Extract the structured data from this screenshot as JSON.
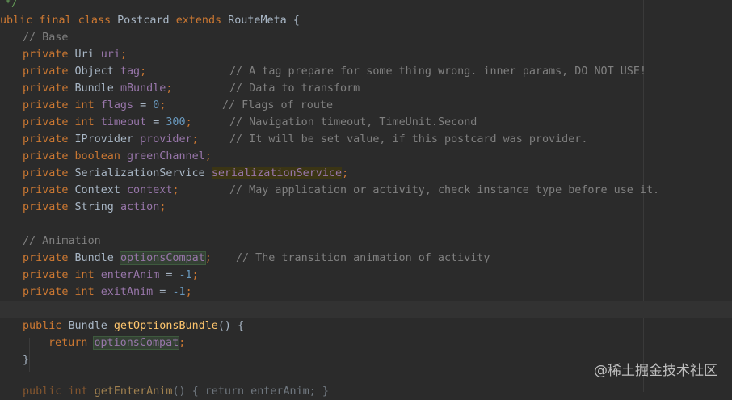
{
  "code": {
    "l0": "*/",
    "l1": {
      "kw1": "ublic final class",
      "name": "Postcard",
      "kw2": "extends",
      "base": "RouteMeta {"
    },
    "l2": "// Base",
    "fields": [
      {
        "kw": "private",
        "type": "Uri",
        "name": "uri",
        "tail": ";",
        "comment": ""
      },
      {
        "kw": "private",
        "type": "Object",
        "name": "tag",
        "tail": ";",
        "comment": "// A tag prepare for some thing wrong. inner params, DO NOT USE!"
      },
      {
        "kw": "private",
        "type": "Bundle",
        "name": "mBundle",
        "tail": ";",
        "comment": "// Data to transform"
      },
      {
        "kw": "private int",
        "type": "",
        "name": "flags",
        "assign": " = ",
        "value": "0",
        "tail": ";",
        "comment": "// Flags of route"
      },
      {
        "kw": "private int",
        "type": "",
        "name": "timeout",
        "assign": " = ",
        "value": "300",
        "tail": ";",
        "comment": "// Navigation timeout, TimeUnit.Second"
      },
      {
        "kw": "private",
        "type": "IProvider",
        "name": "provider",
        "tail": ";",
        "comment": "// It will be set value, if this postcard was provider."
      },
      {
        "kw": "private boolean",
        "type": "",
        "name": "greenChannel",
        "tail": ";",
        "comment": ""
      },
      {
        "kw": "private",
        "type": "SerializationService",
        "name": "serializationService",
        "tail": ";",
        "comment": ""
      },
      {
        "kw": "private",
        "type": "Context",
        "name": "context",
        "tail": ";",
        "comment": "// May application or activity, check instance type before use it."
      },
      {
        "kw": "private",
        "type": "String",
        "name": "action",
        "tail": ";",
        "comment": ""
      }
    ],
    "anim_comment": "// Animation",
    "anim": [
      {
        "kw": "private",
        "type": "Bundle",
        "name": "optionsCompat",
        "tail": ";",
        "comment": "// The transition animation of activity"
      },
      {
        "kw": "private int",
        "type": "",
        "name": "enterAnim",
        "assign": " = ",
        "value": "-1",
        "tail": ";",
        "comment": ""
      },
      {
        "kw": "private int",
        "type": "",
        "name": "exitAnim",
        "assign": " = ",
        "value": "-1",
        "tail": ";",
        "comment": ""
      }
    ],
    "method": {
      "kw": "public",
      "type": "Bundle",
      "name": "getOptionsBundle",
      "sig": "() {",
      "ret_kw": "return",
      "ret_val": "optionsCompat",
      "ret_tail": ";",
      "close": "}"
    },
    "cut_line": {
      "kw": "public int",
      "name": "getEnterAnim",
      "rest": "() { return enterAnim; }"
    }
  },
  "watermark": "@稀土掘金技术社区"
}
